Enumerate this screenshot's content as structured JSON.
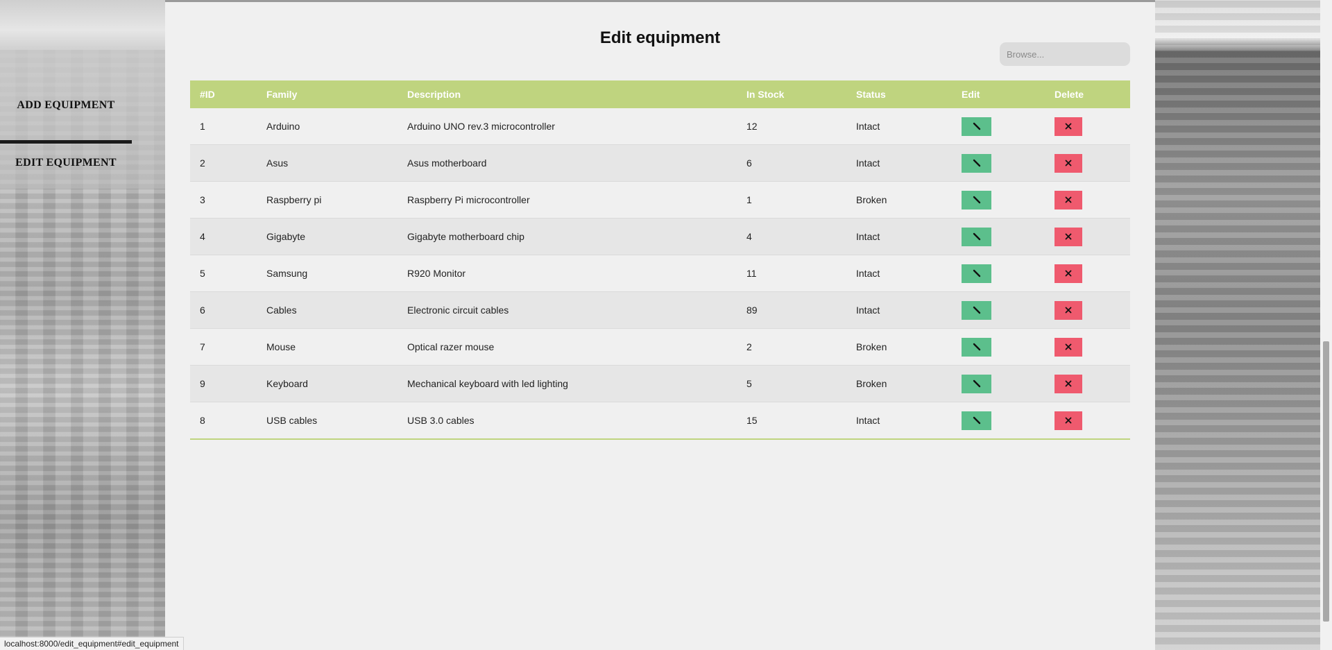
{
  "sidebar": {
    "items": [
      {
        "label": "ADD EQUIPMENT"
      },
      {
        "label": "EDIT EQUIPMENT"
      }
    ]
  },
  "main": {
    "title": "Edit equipment",
    "search": {
      "placeholder": "Browse..."
    }
  },
  "table": {
    "headers": [
      "#ID",
      "Family",
      "Description",
      "In Stock",
      "Status",
      "Edit",
      "Delete"
    ],
    "rows": [
      {
        "id": "1",
        "family": "Arduino",
        "description": "Arduino UNO rev.3 microcontroller",
        "stock": "12",
        "status": "Intact"
      },
      {
        "id": "2",
        "family": "Asus",
        "description": "Asus motherboard",
        "stock": "6",
        "status": "Intact"
      },
      {
        "id": "3",
        "family": "Raspberry pi",
        "description": "Raspberry Pi microcontroller",
        "stock": "1",
        "status": "Broken"
      },
      {
        "id": "4",
        "family": "Gigabyte",
        "description": "Gigabyte motherboard chip",
        "stock": "4",
        "status": "Intact"
      },
      {
        "id": "5",
        "family": "Samsung",
        "description": "R920 Monitor",
        "stock": "11",
        "status": "Intact"
      },
      {
        "id": "6",
        "family": "Cables",
        "description": "Electronic circuit cables",
        "stock": "89",
        "status": "Intact"
      },
      {
        "id": "7",
        "family": "Mouse",
        "description": "Optical razer mouse",
        "stock": "2",
        "status": "Broken"
      },
      {
        "id": "9",
        "family": "Keyboard",
        "description": "Mechanical keyboard with led lighting",
        "stock": "5",
        "status": "Broken"
      },
      {
        "id": "8",
        "family": "USB cables",
        "description": "USB 3.0 cables",
        "stock": "15",
        "status": "Intact"
      }
    ]
  },
  "colors": {
    "header_bg": "#bfd47f",
    "edit_button": "#5cbf8c",
    "delete_button": "#ef5a6e"
  },
  "icons": {
    "edit": "pencil-icon",
    "delete": "close-icon"
  },
  "statusbar": {
    "url": "localhost:8000/edit_equipment#edit_equipment"
  }
}
